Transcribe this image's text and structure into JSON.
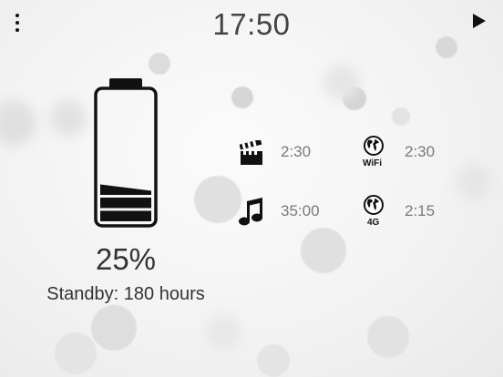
{
  "clock": {
    "time": "17:50"
  },
  "battery": {
    "percent_label": "25%",
    "level": 0.25,
    "standby_label": "Standby: 180 hours"
  },
  "usage": {
    "video": {
      "icon": "clapperboard-icon",
      "value": "2:30"
    },
    "music": {
      "icon": "music-note-icon",
      "value": "35:00"
    },
    "wifi": {
      "icon": "globe-icon",
      "label": "WiFi",
      "value": "2:30"
    },
    "cellular": {
      "icon": "globe-icon",
      "label": "4G",
      "value": "2:15"
    }
  },
  "controls": {
    "menu_icon": "vertical-dots-menu-icon",
    "play_icon": "play-icon"
  },
  "colors": {
    "background": "#f3f3f3",
    "foreground": "#111111",
    "value_text": "#7a7a7a"
  }
}
